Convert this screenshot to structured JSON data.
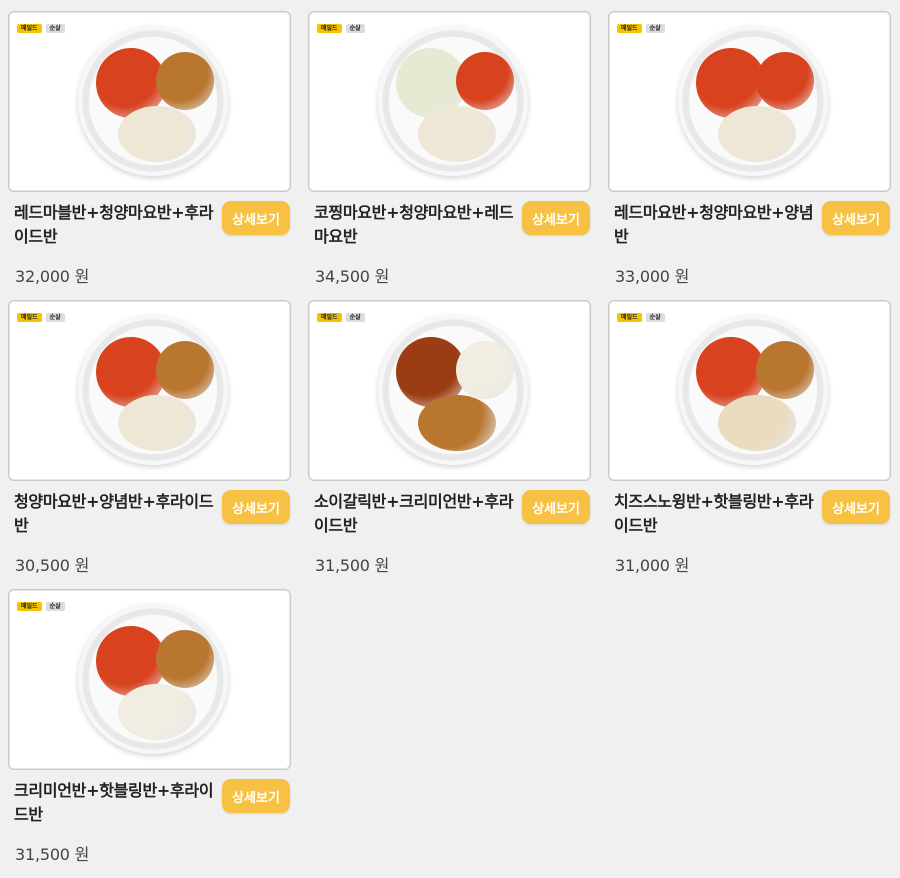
{
  "badges": {
    "mild": "매일드",
    "boneless": "순살"
  },
  "detail_label": "상세보기",
  "products": [
    {
      "title": "레드마블반+청양마요반+후라이드반",
      "price": "32,000 원",
      "foods": [
        "red",
        "fried",
        "mayo"
      ]
    },
    {
      "title": "코찡마요반+청양마요반+레드마요반",
      "price": "34,500 원",
      "foods": [
        "onion",
        "red",
        "mayo"
      ]
    },
    {
      "title": "레드마요반+청양마요반+양념반",
      "price": "33,000 원",
      "foods": [
        "red",
        "red",
        "mayo"
      ]
    },
    {
      "title": "청양마요반+양념반+후라이드반",
      "price": "30,500 원",
      "foods": [
        "red",
        "fried",
        "mayo"
      ]
    },
    {
      "title": "소이갈릭반+크리미언반+후라이드반",
      "price": "31,500 원",
      "foods": [
        "soy",
        "cream",
        "fried"
      ]
    },
    {
      "title": "치즈스노윙반+핫블링반+후라이드반",
      "price": "31,000 원",
      "foods": [
        "red",
        "fried",
        "cheese"
      ]
    },
    {
      "title": "크리미언반+핫블링반+후라이드반",
      "price": "31,500 원",
      "foods": [
        "red",
        "fried",
        "cream"
      ]
    }
  ],
  "food_colors": {
    "red": "#d8421f",
    "fried": "#b9762f",
    "mayo": "#efe7d6",
    "onion": "#e6ead2",
    "soy": "#9b3d14",
    "cream": "#f2ede3",
    "cheese": "#e9dcc0"
  }
}
